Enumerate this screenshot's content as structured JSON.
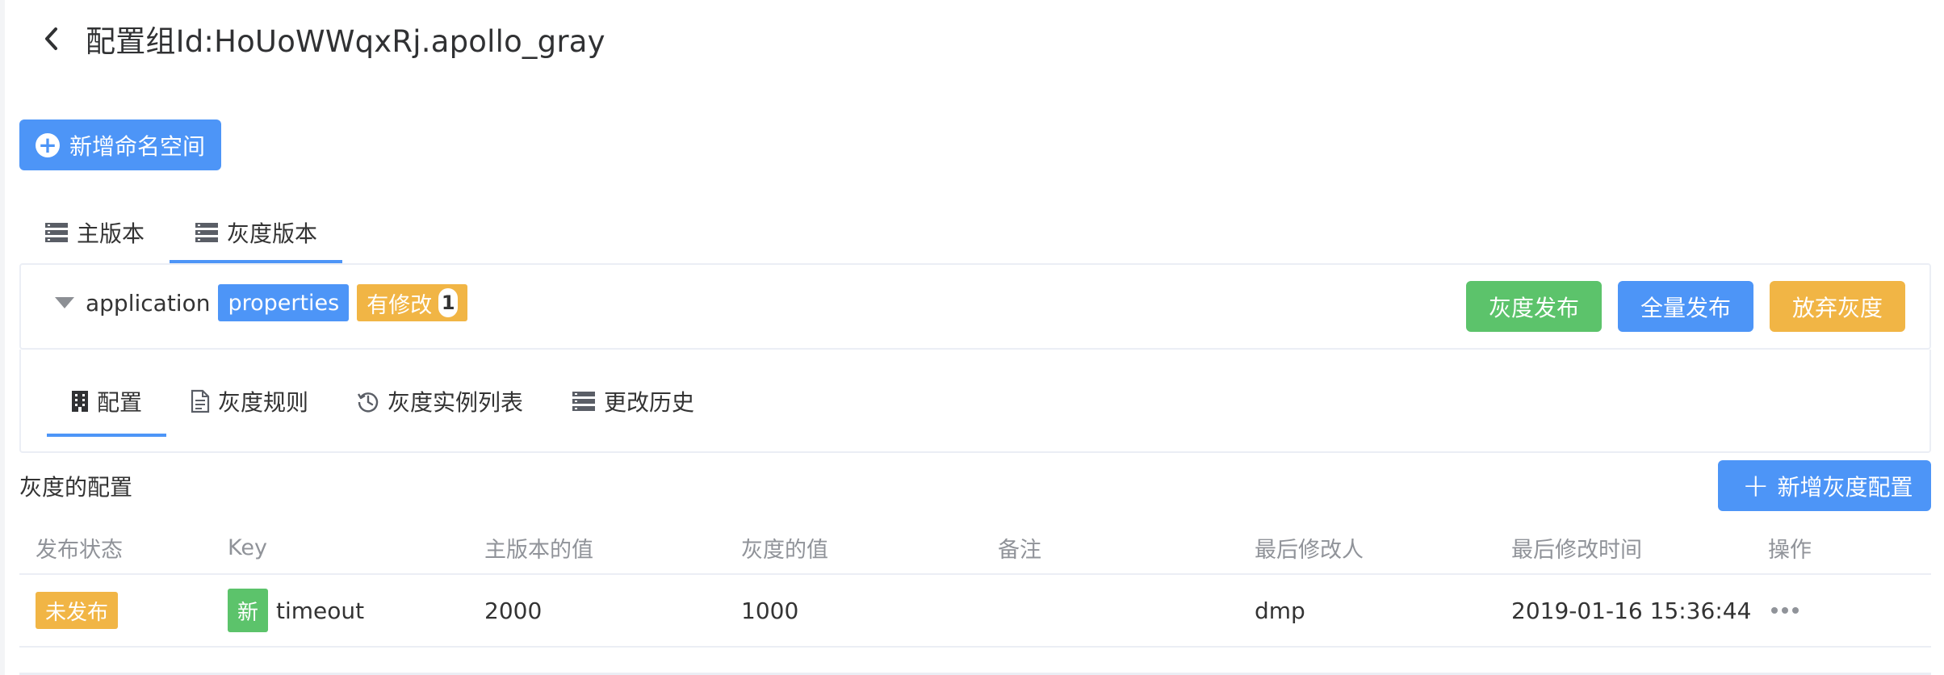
{
  "header": {
    "title": "配置组Id:HoUoWWqxRj.apollo_gray"
  },
  "toolbar": {
    "add_namespace_label": "新增命名空间"
  },
  "top_tabs": [
    {
      "label": "主版本",
      "icon": "server-icon",
      "active": false
    },
    {
      "label": "灰度版本",
      "icon": "server-icon",
      "active": true
    }
  ],
  "namespace": {
    "name": "application",
    "format_tag": "properties",
    "modified_tag": "有修改",
    "modified_count": "1",
    "actions": {
      "gray_publish": "灰度发布",
      "full_publish": "全量发布",
      "abandon_gray": "放弃灰度"
    }
  },
  "sub_tabs": [
    {
      "label": "配置",
      "icon": "building-icon",
      "active": true
    },
    {
      "label": "灰度规则",
      "icon": "document-icon",
      "active": false
    },
    {
      "label": "灰度实例列表",
      "icon": "history-icon",
      "active": false
    },
    {
      "label": "更改历史",
      "icon": "server-icon",
      "active": false
    }
  ],
  "gray_config": {
    "section_title": "灰度的配置",
    "add_button_label": "新增灰度配置",
    "columns": [
      "发布状态",
      "Key",
      "主版本的值",
      "灰度的值",
      "备注",
      "最后修改人",
      "最后修改时间",
      "操作"
    ],
    "rows": [
      {
        "status": "未发布",
        "new_tag": "新",
        "key": "timeout",
        "main_value": "2000",
        "gray_value": "1000",
        "comment": "",
        "modifier": "dmp",
        "modified_time": "2019-01-16 15:36:44"
      }
    ]
  },
  "colors": {
    "primary": "#4d95f7",
    "success": "#5cc36b",
    "warning": "#f1b545",
    "muted_text": "#909399"
  }
}
